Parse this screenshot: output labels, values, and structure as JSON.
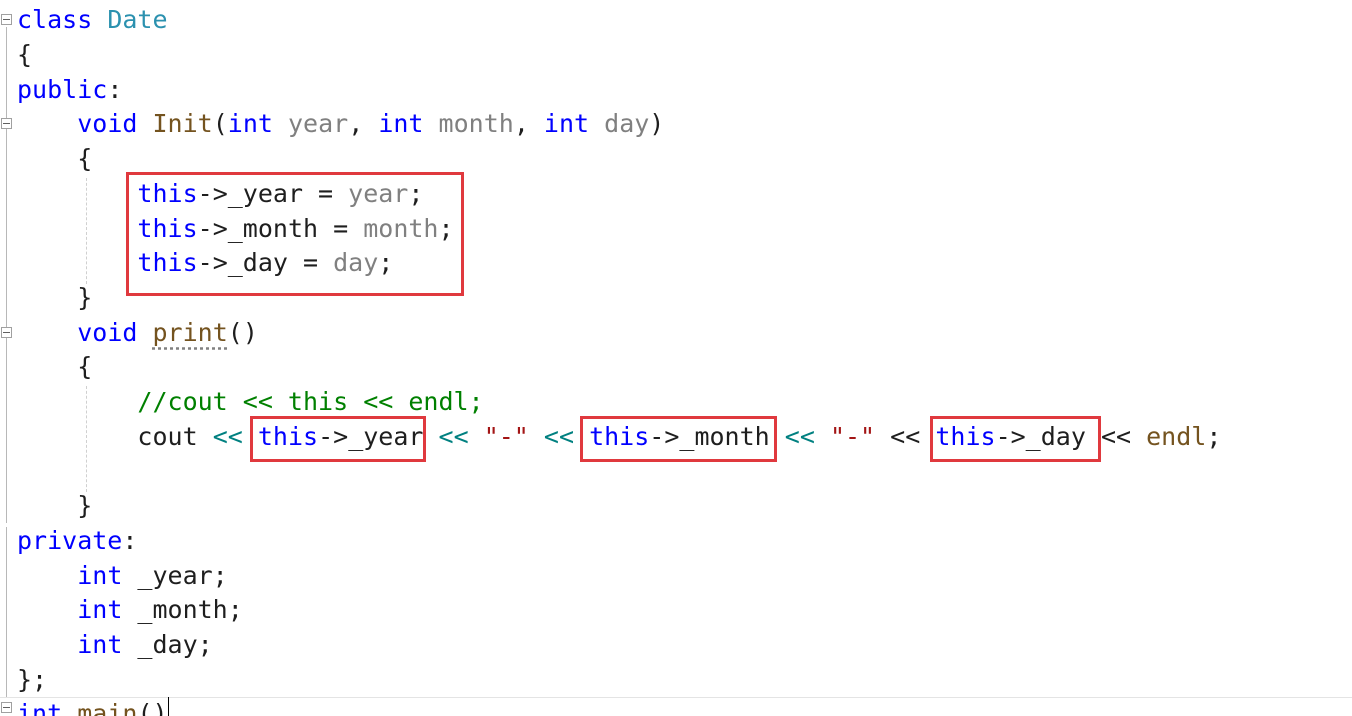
{
  "editor": {
    "language": "C++",
    "lines": {
      "l1": {
        "kw": "class",
        "name": "Date"
      },
      "l2": {
        "text": "{"
      },
      "l3": {
        "label": "public",
        "colon": ":"
      },
      "l4": {
        "ret": "void",
        "fn": "Init",
        "p1t": "int",
        "p1": "year",
        "p2t": "int",
        "p2": "month",
        "p3t": "int",
        "p3": "day"
      },
      "l5": {
        "text": "{"
      },
      "l6": {
        "this": "this",
        "member": "->_year = ",
        "param": "year",
        "end": ";"
      },
      "l7": {
        "this": "this",
        "member": "->_month = ",
        "param": "month",
        "end": ";"
      },
      "l8": {
        "this": "this",
        "member": "->_day = ",
        "param": "day",
        "end": ";"
      },
      "l9": {
        "text": "}"
      },
      "l10": {
        "ret": "void",
        "fn": "print",
        "parens": "()"
      },
      "l11": {
        "text": "{"
      },
      "l12": {
        "comment": "//cout << this << endl;"
      },
      "l13": {
        "cout": "cout",
        "op": "<<",
        "this": "this",
        "year": "->_year",
        "month": "->_month",
        "day": "->_day",
        "dash": "\"-\"",
        "endl": "endl",
        "end": ";"
      },
      "l14": {
        "text": ""
      },
      "l15": {
        "text": "}"
      },
      "l16": {
        "label": "private",
        "colon": ":"
      },
      "l17": {
        "kw": "int",
        "rest": " _year;"
      },
      "l18": {
        "kw": "int",
        "rest": " _month;"
      },
      "l19": {
        "kw": "int",
        "rest": " _day;"
      },
      "l20": {
        "text": "};"
      },
      "l21": {
        "kw": "int",
        "fn": "main",
        "parens": "()"
      }
    }
  },
  "colors": {
    "keyword": "#0000ff",
    "type": "#2b91af",
    "function": "#74531f",
    "parameter": "#808080",
    "string": "#a31515",
    "operator": "#008080",
    "comment": "#008000",
    "highlight_box": "#e0393e"
  }
}
